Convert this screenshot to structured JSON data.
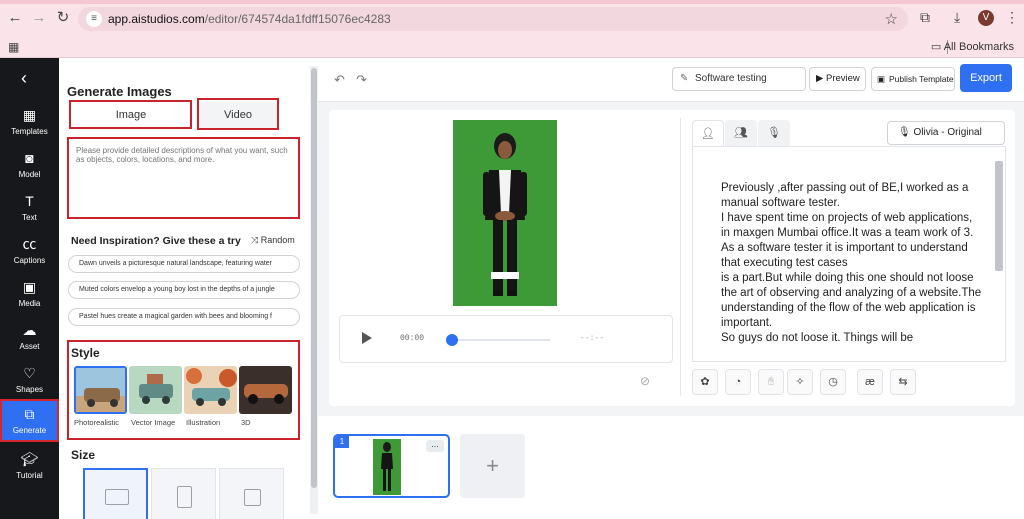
{
  "browser": {
    "url_host": "app.aistudios.com",
    "url_path": "/editor/674574da1fdff15076ec4283",
    "avatar_letter": "V",
    "bookmarks_label": "All Bookmarks"
  },
  "rail": {
    "items": [
      {
        "label": "Templates",
        "icon": "templates-icon"
      },
      {
        "label": "Model",
        "icon": "model-icon"
      },
      {
        "label": "Text",
        "icon": "text-icon"
      },
      {
        "label": "Captions",
        "icon": "captions-icon"
      },
      {
        "label": "Media",
        "icon": "media-icon"
      },
      {
        "label": "Asset",
        "icon": "asset-icon"
      },
      {
        "label": "Shapes",
        "icon": "shapes-icon"
      },
      {
        "label": "Generate",
        "icon": "generate-icon",
        "active": true
      },
      {
        "label": "Tutorial",
        "icon": "tutorial-icon"
      }
    ]
  },
  "generate": {
    "title": "Generate Images",
    "tabs": [
      "Image",
      "Video"
    ],
    "prompt_placeholder": "Please provide detailed descriptions of what you want, such as objects, colors, locations, and more.",
    "inspiration_title": "Need Inspiration? Give these a try",
    "random_label": "Random",
    "suggestions": [
      "Dawn unveils a picturesque natural landscape, featuring water",
      "Muted colors envelop a young boy lost in the depths of a jungle",
      "Pastel hues create a magical garden with bees and blooming f"
    ],
    "style_title": "Style",
    "styles": [
      "Photorealistic",
      "Vector Image",
      "Illustration",
      "3D"
    ],
    "size_title": "Size"
  },
  "toolbar": {
    "project_name": "Software testing",
    "preview_label": "Preview",
    "publish_label": "Publish Template",
    "export_label": "Export"
  },
  "player": {
    "current_time": "00:00",
    "duration": "--:--"
  },
  "script": {
    "voice_label": "Olivia - Original Voice",
    "text": "Previously ,after passing out of BE,I worked as a manual software tester.\nI have spent time on projects of web applications, in maxgen Mumbai office.It was a team work of 3.\nAs a software tester it is important to understand that executing test cases\nis a part.But while doing this one should not loose the art of observing and analyzing of a website.The understanding of the flow of the web application is important.\nSo guys do not loose it. Things will be"
  },
  "scenes": {
    "items": [
      {
        "number": "1"
      }
    ],
    "more_label": "..."
  },
  "colors": {
    "accent": "#2f6ff2",
    "highlight_red": "#c9232b",
    "avatar_bg": "#3d9a36",
    "rail_bg": "#17181b"
  }
}
